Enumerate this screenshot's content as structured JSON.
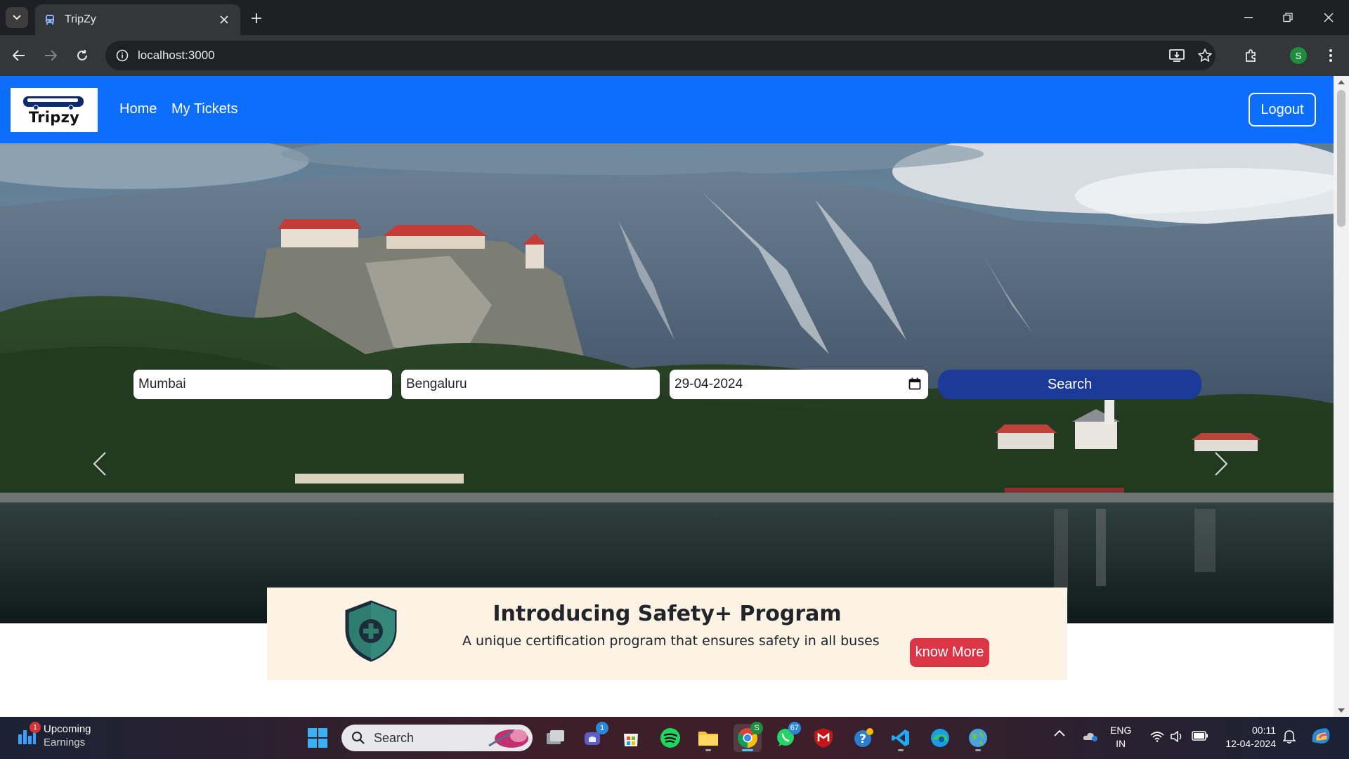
{
  "browser": {
    "tab_title": "TripZy",
    "url": "localhost:3000",
    "profile_initial": "S"
  },
  "site": {
    "brand": "Tripzy",
    "nav": {
      "home": "Home",
      "my_tickets": "My Tickets"
    },
    "logout": "Logout",
    "search": {
      "from_value": "Mumbai",
      "to_value": "Bengaluru",
      "date_value": "29-04-2024",
      "button": "Search"
    },
    "safety": {
      "title": "Introducing Safety+ Program",
      "text": "A unique certification program that ensures safety in all buses",
      "button": "know More"
    }
  },
  "taskbar": {
    "widget_title": "Upcoming",
    "widget_sub": "Earnings",
    "widget_badge": "1",
    "search_placeholder": "Search",
    "teams_badge": "1",
    "whatsapp_badge": "67",
    "chrome_badge": "S",
    "lang_top": "ENG",
    "lang_bottom": "IN",
    "time": "00:11",
    "date": "12-04-2024"
  },
  "colors": {
    "navbar": "#0d6efd",
    "search_button": "#1c3b98",
    "know_more": "#dc3545",
    "safety_bg": "#fdf3e5"
  }
}
